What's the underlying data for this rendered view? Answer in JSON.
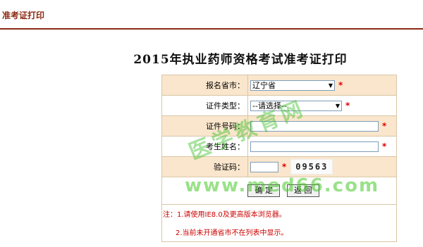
{
  "header": {
    "title": "准考证打印"
  },
  "page": {
    "title": "2015年执业药师资格考试准考证打印"
  },
  "form": {
    "province": {
      "label": "报名省市：",
      "selected": "辽宁省"
    },
    "id_type": {
      "label": "证件类型：",
      "selected": "--请选择--"
    },
    "id_number": {
      "label": "证件号码：",
      "value": ""
    },
    "name": {
      "label": "考生姓名：",
      "value": ""
    },
    "captcha": {
      "label": "验证码：",
      "value": "",
      "image_text": "09563"
    },
    "required_mark": "*"
  },
  "buttons": {
    "confirm": "确 定",
    "back": "返 回"
  },
  "notes": {
    "line1": "注：1.请使用IE8.0及更高版本浏览器。",
    "line2": "2.当前未开通省市不在列表中显示。"
  },
  "watermark": {
    "cn": "医学教育网",
    "url": "www.med66.com"
  },
  "colors": {
    "accent": "#8b2a12",
    "row_shade": "#fae6cc",
    "required": "#e00000"
  }
}
